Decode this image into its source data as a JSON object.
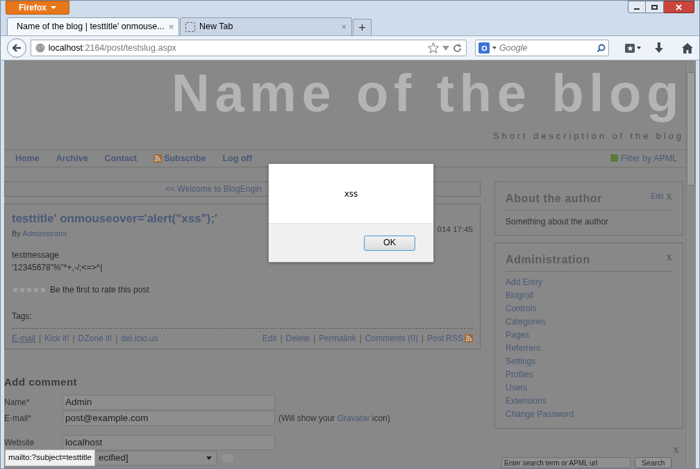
{
  "browser": {
    "menu_button": "Firefox",
    "tabs": [
      {
        "label": "Name of the blog | testtitle' onmouse...",
        "selected": true,
        "close": "×"
      },
      {
        "label": "New Tab",
        "selected": false,
        "close": "×"
      }
    ],
    "new_tab": "+",
    "address": {
      "host": "localhost",
      "path": ":2164/post/testslug.aspx"
    },
    "search": {
      "placeholder": "Google"
    }
  },
  "blog": {
    "title": "Name of the blog",
    "description": "Short description of the blog"
  },
  "nav": {
    "items": [
      {
        "label": "Home",
        "rss": false
      },
      {
        "label": "Archive",
        "rss": false
      },
      {
        "label": "Contact",
        "rss": false
      },
      {
        "label": "Subscribe",
        "rss": true
      },
      {
        "label": "Log off",
        "rss": false
      }
    ],
    "filter": "Filter by APML"
  },
  "post_nav": "<< Welcome to BlogEngin",
  "post": {
    "title": "testtitle' onmouseover='alert(\"xss\");'",
    "author_prefix": "By",
    "author": "Administrator",
    "date": "014 17:45",
    "body": [
      "testmessage",
      "'12345678\"%\"*+,-/;<=>^|"
    ],
    "stars": 0,
    "rating_text": "Be the first to rate this post",
    "tags": "Tags:",
    "separator": "|",
    "share_links": [
      "E-mail",
      "Kick it!",
      "DZone it!",
      "del.icio.us"
    ],
    "actions": [
      "Edit",
      "Delete",
      "Permalink",
      "Comments (0)",
      "Post RSS"
    ]
  },
  "comment_form": {
    "title": "Add comment",
    "fields": [
      {
        "label": "Name*",
        "value": "Admin"
      },
      {
        "label": "E-mail*",
        "value": "post@example.com",
        "note_before": "(Will show your",
        "note_link": "Gravatar",
        "note_after": "icon)"
      },
      {
        "label": "Website",
        "value": "localhost"
      }
    ],
    "country_select": "ecified]"
  },
  "sidebar": {
    "widgets": [
      {
        "title": "About the author",
        "edit": "Edit",
        "close": "X",
        "text": "Something about the author"
      },
      {
        "title": "Administration",
        "close": "X",
        "links": [
          "Add Entry",
          "Blogroll",
          "Controls",
          "Categories",
          "Pages",
          "Referrers",
          "Settings",
          "Profiles",
          "Users",
          "Extensions",
          "Change Password"
        ]
      }
    ],
    "search_widget": {
      "close": "X",
      "placeholder": "Enter search term or APML url",
      "button": "Search"
    }
  },
  "dialog": {
    "message": "xss",
    "button": "OK"
  },
  "status_tooltip": "mailto:?subject=testtitle"
}
